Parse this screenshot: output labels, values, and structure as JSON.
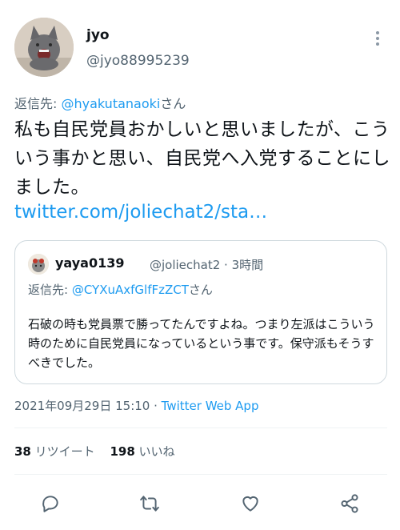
{
  "author": {
    "display_name": "jyo",
    "handle": "@jyo88995239"
  },
  "reply_to": {
    "prefix": "返信先: ",
    "handle": "@hyakutanaoki",
    "suffix": "さん"
  },
  "tweet": {
    "text": "私も自民党員おかしいと思いましたが、こういう事かと思い、自民党へ入党することにしました。",
    "link": "twitter.com/joliechat2/sta…"
  },
  "quoted": {
    "display_name": "yaya0139",
    "meta": "@joliechat2 · 3時間",
    "reply_prefix": "返信先: ",
    "reply_handle": "@CYXuAxfGlfFzZCT",
    "reply_suffix": "さん",
    "text": "石破の時も党員票で勝ってたんですよね。つまり左派はこういう時のために自民党員になっているという事です。保守派もそうすべきでした。"
  },
  "meta": {
    "timestamp": "2021年09月29日 15:10",
    "separator": " · ",
    "source": "Twitter Web App"
  },
  "stats": {
    "retweets_count": "38",
    "retweets_label": "リツイート",
    "likes_count": "198",
    "likes_label": "いいね"
  },
  "colors": {
    "accent": "#1d9bf0",
    "secondary_text": "#536471",
    "border": "#cfd9de"
  },
  "icons": {
    "more": "more-vertical-icon",
    "reply": "reply-icon",
    "retweet": "retweet-icon",
    "like": "heart-icon",
    "share": "share-icon"
  }
}
